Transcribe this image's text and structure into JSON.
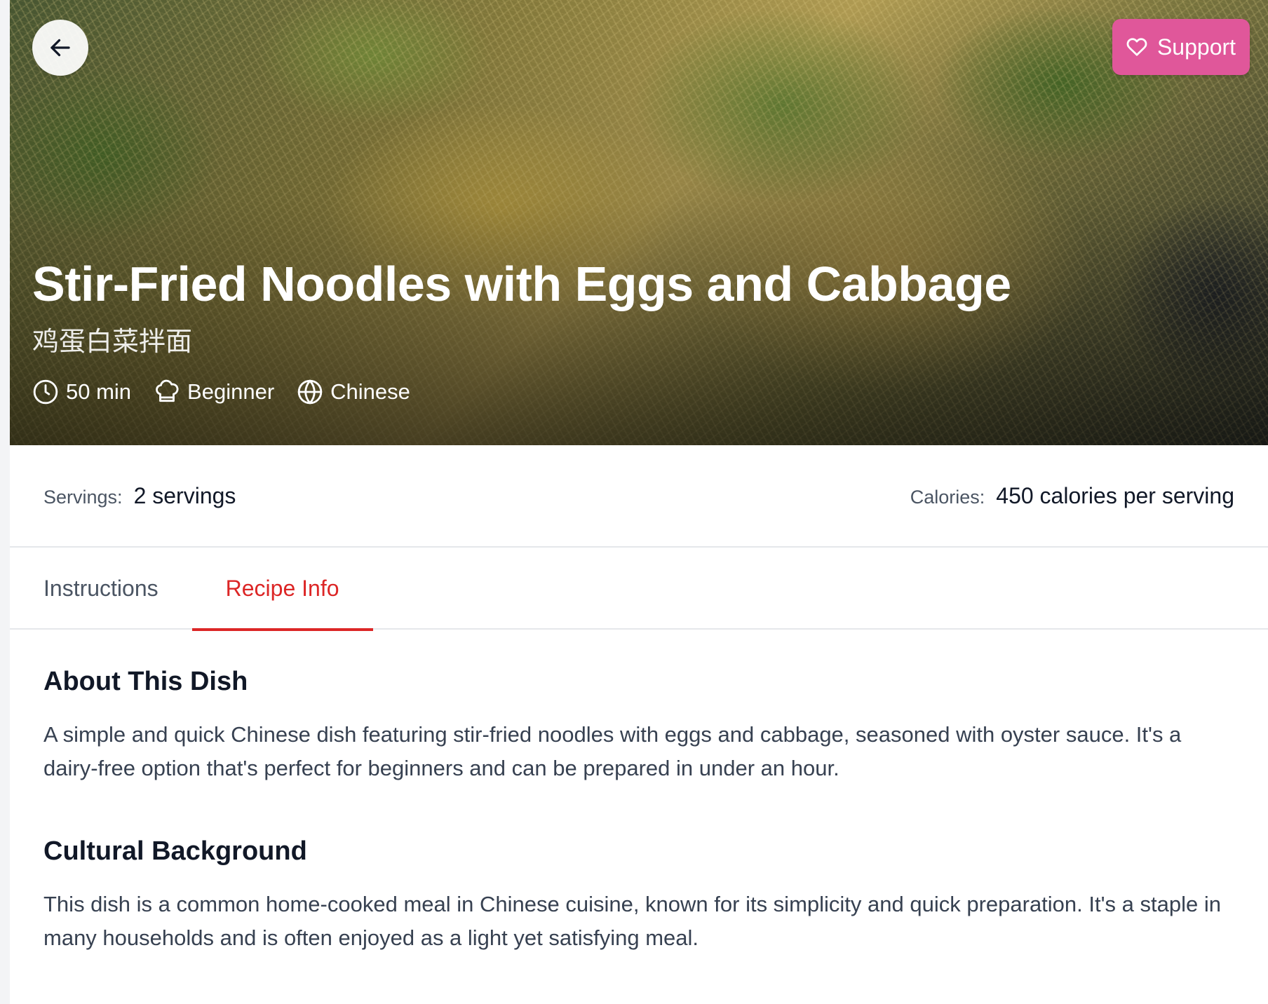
{
  "hero": {
    "title": "Stir-Fried Noodles with Eggs and Cabbage",
    "subtitle": "鸡蛋白菜拌面",
    "meta": {
      "time": "50 min",
      "difficulty": "Beginner",
      "cuisine": "Chinese"
    },
    "support_label": "Support",
    "support_color": "#e0579a"
  },
  "stats": {
    "servings_label": "Servings:",
    "servings_value": "2 servings",
    "calories_label": "Calories:",
    "calories_value": "450 calories per serving"
  },
  "tabs": [
    {
      "label": "Instructions",
      "active": false
    },
    {
      "label": "Recipe Info",
      "active": true
    }
  ],
  "accent_color": "#dc2626",
  "sections": [
    {
      "heading": "About This Dish",
      "body": "A simple and quick Chinese dish featuring stir-fried noodles with eggs and cabbage, seasoned with oyster sauce. It's a dairy-free option that's perfect for beginners and can be prepared in under an hour."
    },
    {
      "heading": "Cultural Background",
      "body": "This dish is a common home-cooked meal in Chinese cuisine, known for its simplicity and quick preparation. It's a staple in many households and is often enjoyed as a light yet satisfying meal."
    }
  ],
  "icons": {
    "back": "arrow-left-icon",
    "support": "heart-icon",
    "time": "clock-icon",
    "difficulty": "chef-hat-icon",
    "cuisine": "globe-icon"
  }
}
